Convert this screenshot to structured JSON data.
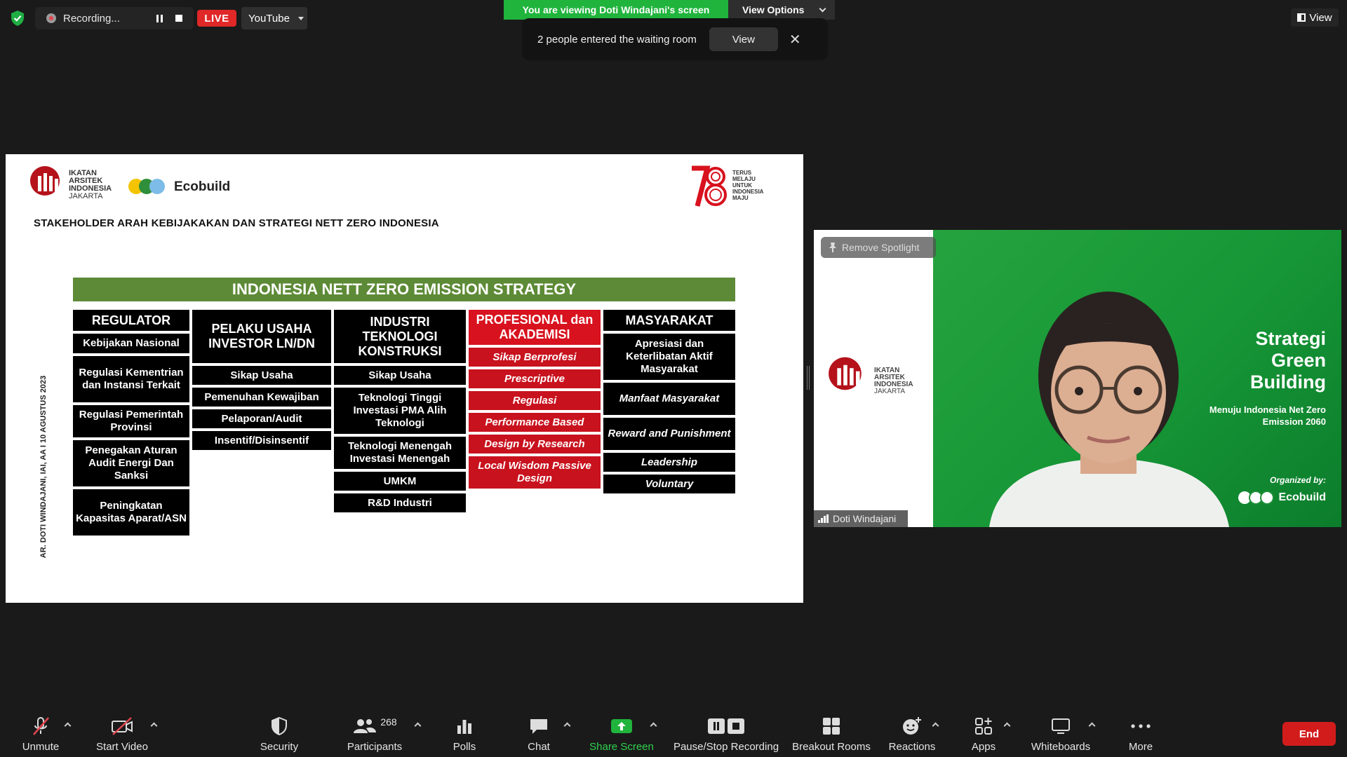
{
  "topbar": {
    "recording_label": "Recording...",
    "live_label": "LIVE",
    "stream_target": "YouTube",
    "viewing_banner": "You are viewing Doti Windajani's screen",
    "view_options_label": "View Options",
    "toast_message": "2 people entered the waiting room",
    "toast_view_button": "View",
    "toast_close_glyph": "✕",
    "view_button": "View"
  },
  "slide": {
    "iai_logo_text": [
      "IKATAN",
      "ARSITEK",
      "INDONESIA",
      "JAKARTA"
    ],
    "ecobuild_text": "Ecobuild",
    "ri78_text": [
      "TERUS",
      "MELAJU",
      "UNTUK",
      "INDONESIA",
      "MAJU"
    ],
    "title": "STAKEHOLDER ARAH KEBIJAKAKAN DAN STRATEGI NETT ZERO  INDONESIA",
    "side_text": "AR. DOTI WINDAJANI, IAI, AA I 10 AGUSTUS 2023",
    "banner": "INDONESIA NETT ZERO EMISSION STRATEGY",
    "columns": [
      {
        "header": "REGULATOR",
        "items": [
          "Kebijakan Nasional",
          "Regulasi Kementrian dan Instansi Terkait",
          "Regulasi Pemerintah Provinsi",
          "Penegakan Aturan Audit Energi Dan Sanksi",
          "Peningkatan Kapasitas Aparat/ASN"
        ]
      },
      {
        "header": "PELAKU USAHA INVESTOR LN/DN",
        "items": [
          "Sikap Usaha",
          "Pemenuhan Kewajiban",
          "Pelaporan/Audit",
          "Insentif/Disinsentif"
        ]
      },
      {
        "header": "INDUSTRI TEKNOLOGI KONSTRUKSI",
        "items": [
          "Sikap Usaha",
          "Teknologi Tinggi Investasi PMA Alih Teknologi",
          "Teknologi Menengah Investasi Menengah",
          "UMKM",
          "R&D Industri"
        ]
      },
      {
        "header": "PROFESIONAL dan AKADEMISI",
        "items": [
          "Sikap Berprofesi",
          "Prescriptive",
          "Regulasi",
          "Performance Based",
          "Design by Research",
          "Local Wisdom Passive Design"
        ]
      },
      {
        "header": "MASYARAKAT",
        "items": [
          "Apresiasi dan Keterlibatan Aktif Masyarakat",
          "Manfaat Masyarakat",
          "Reward and Punishment",
          "Leadership",
          "Voluntary"
        ]
      }
    ]
  },
  "video": {
    "remove_spotlight": "Remove Spotlight",
    "background_title": "Strategi Green Building",
    "background_subtitle": "Menuju Indonesia Net Zero Emission 2060",
    "organized_by": "Organized by:",
    "organizer": "Ecobuild",
    "iai_text": [
      "IKATAN",
      "ARSITEK",
      "INDONESIA",
      "JAKARTA"
    ],
    "participant_name": "Doti Windajani"
  },
  "toolbar": {
    "unmute": "Unmute",
    "start_video": "Start Video",
    "security": "Security",
    "participants": "Participants",
    "participants_count": "268",
    "polls": "Polls",
    "chat": "Chat",
    "share_screen": "Share Screen",
    "pause_stop_recording": "Pause/Stop Recording",
    "breakout_rooms": "Breakout Rooms",
    "reactions": "Reactions",
    "apps": "Apps",
    "whiteboards": "Whiteboards",
    "more": "More",
    "end": "End"
  },
  "colors": {
    "banner_green": "#5d8a36",
    "share_green": "#20b43d",
    "live_red": "#e02828",
    "end_red": "#d21c1c",
    "academic_red": "#c8121e"
  }
}
